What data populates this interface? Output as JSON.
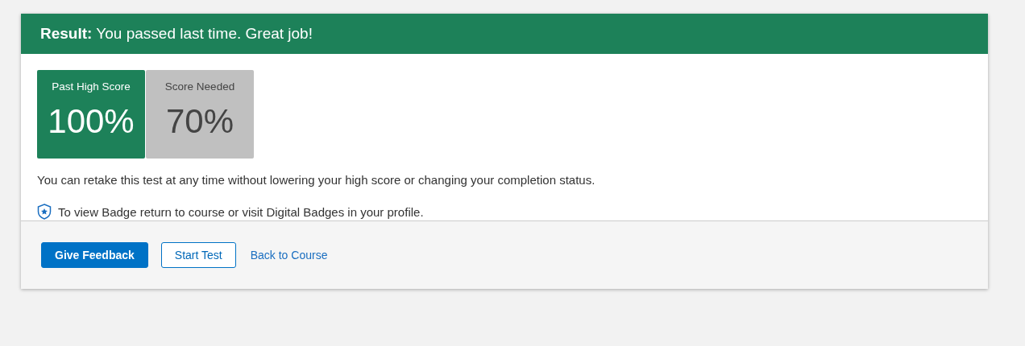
{
  "result_banner": {
    "text": "**Result:** You passed last time. Great job!"
  },
  "scores": [
    {
      "kind": "achieved",
      "label": "Past High Score",
      "value": "100%"
    },
    {
      "kind": "required",
      "label": "Score Needed",
      "value": "70%"
    }
  ],
  "messages": [
    {
      "kind": "plain",
      "text": "You can retake this test at any time without lowering your high score or changing your completion status."
    },
    {
      "kind": "badge",
      "text": "To view Badge return to course or visit Digital Badges in your profile."
    }
  ],
  "actions": [
    {
      "kind": "primary",
      "label": "Give Feedback"
    },
    {
      "kind": "outline",
      "label": "Start Test"
    },
    {
      "kind": "link",
      "label": "Back to Course"
    }
  ]
}
